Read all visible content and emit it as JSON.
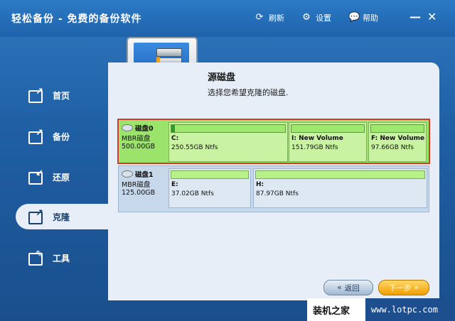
{
  "window": {
    "title": "轻松备份 - 免费的备份软件"
  },
  "toolbar": {
    "refresh_label": "刷新",
    "settings_label": "设置",
    "help_label": "帮助",
    "minimize_glyph": "—",
    "close_glyph": "✕"
  },
  "sidebar": {
    "items": [
      {
        "label": "首页",
        "icon": "home-icon"
      },
      {
        "label": "备份",
        "icon": "backup-icon"
      },
      {
        "label": "还原",
        "icon": "restore-icon"
      },
      {
        "label": "克隆",
        "icon": "clone-icon",
        "active": true
      },
      {
        "label": "工具",
        "icon": "tools-icon"
      }
    ]
  },
  "main": {
    "section_title": "源磁盘",
    "section_desc": "选择您希望克隆的磁盘.",
    "disks": [
      {
        "name": "磁盘0",
        "type": "MBR磁盘",
        "size": "500.00GB",
        "selected": true,
        "partitions": [
          {
            "label": "C:",
            "size": "250.55GB Ntfs",
            "used_fraction": 0.03
          },
          {
            "label": "I: New Volume",
            "size": "151.79GB Ntfs",
            "used_fraction": 0.0
          },
          {
            "label": "F: New Volume",
            "size": "97.66GB Ntfs",
            "used_fraction": 0.0
          }
        ]
      },
      {
        "name": "磁盘1",
        "type": "MBR磁盘",
        "size": "125.00GB",
        "selected": false,
        "partitions": [
          {
            "label": "E:",
            "size": "37.02GB Ntfs",
            "used_fraction": 0.0
          },
          {
            "label": "H:",
            "size": "87.97GB Ntfs",
            "used_fraction": 0.0
          }
        ]
      }
    ]
  },
  "footer": {
    "back_label": "返回",
    "next_label": "下一步"
  },
  "watermark": {
    "left": "装机之家",
    "right": "www.lotpc.com"
  },
  "colors": {
    "accent": "#1f5fa4",
    "selected_disk": "#9be46b",
    "selection_border": "#d23a2a",
    "next_button": "#f0a000"
  }
}
